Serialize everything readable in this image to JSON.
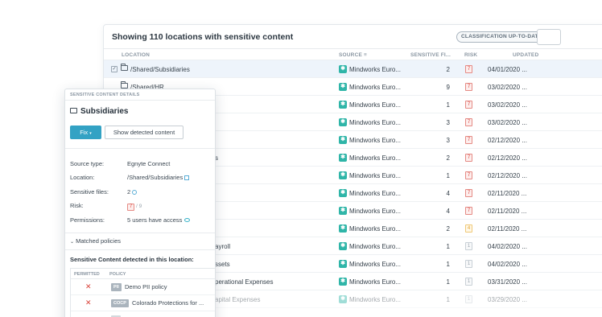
{
  "header": {
    "title": "Showing 110 locations with sensitive content",
    "badge": "CLASSIFICATION UP-TO-DATE"
  },
  "columns": {
    "location": "LOCATION",
    "source": "SOURCE",
    "sensitive": "SENSITIVE FI...",
    "risk": "RISK",
    "updated": "UPDATED"
  },
  "rows": [
    {
      "location": "/Shared/Subsidiaries",
      "source": "Mindworks Euro...",
      "sensitive": "2",
      "risk": "7",
      "risk_level": "high",
      "updated": "04/01/2020 ...",
      "checked": "✓"
    },
    {
      "location": "/Shared/HR",
      "source": "Mindworks Euro...",
      "sensitive": "9",
      "risk": "7",
      "risk_level": "high",
      "updated": "03/02/2020 ..."
    },
    {
      "location": "",
      "source": "Mindworks Euro...",
      "sensitive": "1",
      "risk": "7",
      "risk_level": "high",
      "updated": "03/02/2020 ..."
    },
    {
      "location": "",
      "source": "Mindworks Euro...",
      "sensitive": "3",
      "risk": "7",
      "risk_level": "high",
      "updated": "03/02/2020 ..."
    },
    {
      "location": "",
      "source": "Mindworks Euro...",
      "sensitive": "3",
      "risk": "7",
      "risk_level": "high",
      "updated": "02/12/2020 ..."
    },
    {
      "location": "s",
      "source": "Mindworks Euro...",
      "sensitive": "2",
      "risk": "7",
      "risk_level": "high",
      "updated": "02/12/2020 ..."
    },
    {
      "location": "",
      "source": "Mindworks Euro...",
      "sensitive": "1",
      "risk": "7",
      "risk_level": "high",
      "updated": "02/12/2020 ..."
    },
    {
      "location": "",
      "source": "Mindworks Euro...",
      "sensitive": "4",
      "risk": "7",
      "risk_level": "high",
      "updated": "02/11/2020 ..."
    },
    {
      "location": "",
      "source": "Mindworks Euro...",
      "sensitive": "4",
      "risk": "7",
      "risk_level": "high",
      "updated": "02/11/2020 ..."
    },
    {
      "location": "",
      "source": "Mindworks Euro...",
      "sensitive": "2",
      "risk": "4",
      "risk_level": "med",
      "updated": "02/11/2020 ..."
    },
    {
      "location": "ayroll",
      "source": "Mindworks Euro...",
      "sensitive": "1",
      "risk": "1",
      "risk_level": "low",
      "updated": "04/02/2020 ..."
    },
    {
      "location": "ssets",
      "source": "Mindworks Euro...",
      "sensitive": "1",
      "risk": "1",
      "risk_level": "low",
      "updated": "04/02/2020 ..."
    },
    {
      "location": "perational Expenses",
      "source": "Mindworks Euro...",
      "sensitive": "1",
      "risk": "1",
      "risk_level": "low",
      "updated": "03/31/2020 ..."
    },
    {
      "location": "apital Expenses",
      "source": "Mindworks Euro...",
      "sensitive": "1",
      "risk": "1",
      "risk_level": "low",
      "updated": "03/29/2020 ..."
    }
  ],
  "detail": {
    "header": "SENSITIVE CONTENT DETAILS",
    "title": "Subsidiaries",
    "fix_label": "Fix",
    "show_label": "Show detected content",
    "fields": [
      {
        "key": "Source type:",
        "value": "Egnyte Connect"
      },
      {
        "key": "Location:",
        "value": "/Shared/Subsidiaries"
      },
      {
        "key": "Sensitive files:",
        "value": "2"
      },
      {
        "key": "Risk:",
        "value": "7",
        "max": "/ 9"
      },
      {
        "key": "Permissions:",
        "value": "5 users have access"
      }
    ],
    "matched_label": "Matched policies",
    "detected_label": "Sensitive Content detected in this location:",
    "policy_cols": {
      "permitted": "PERMITTED",
      "policy": "POLICY"
    },
    "policies": [
      {
        "tag": "PII",
        "name": "Demo PII policy"
      },
      {
        "tag": "COCP",
        "name": "Colorado Protections for ..."
      }
    ]
  },
  "colors": {
    "accent": "#33a2c4",
    "source_icon": "#2fb5a8",
    "risk_high": "#d9433a",
    "risk_med": "#e2a22c"
  }
}
